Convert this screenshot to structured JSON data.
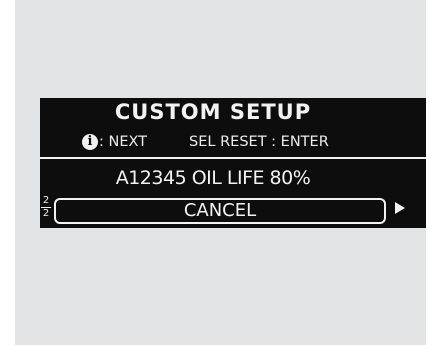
{
  "screen": {
    "title": "CUSTOM SETUP",
    "help": {
      "info_icon_glyph": "i",
      "next_label": ": NEXT",
      "select_reset_label": "SEL RESET : ENTER"
    },
    "item_line": "A12345 OIL LIFE 80%",
    "page_indicator": {
      "current": "2",
      "total": "2"
    },
    "cancel_label": "CANCEL",
    "arrow_icon": "right-triangle"
  },
  "colors": {
    "panel_background": "#e3e4e5",
    "display_background": "#0d0d0d",
    "display_text": "#f2f2f2"
  }
}
